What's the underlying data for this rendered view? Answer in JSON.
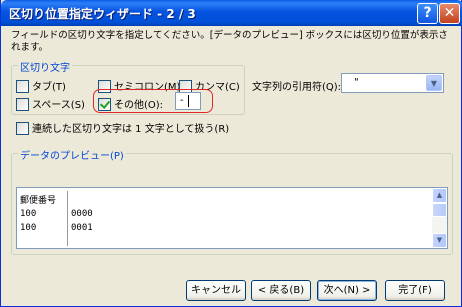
{
  "window": {
    "title": "区切り位置指定ウィザード - 2 / 3",
    "help_glyph": "?",
    "close_glyph": "✕"
  },
  "instruction": "フィールドの区切り文字を指定してください。[データのプレビュー] ボックスには区切り位置が表示されます。",
  "delimiters": {
    "group_label": "区切り文字",
    "tab": {
      "label": "タブ(T)",
      "checked": false
    },
    "semicolon": {
      "label": "セミコロン(M)",
      "checked": false
    },
    "comma": {
      "label": "カンマ(C)",
      "checked": false
    },
    "space": {
      "label": "スペース(S)",
      "checked": false
    },
    "other": {
      "label": "その他(O):",
      "checked": true,
      "value": "-"
    }
  },
  "text_qualifier": {
    "label": "文字列の引用符(Q):",
    "value": "\""
  },
  "consecutive": {
    "label": "連続した区切り文字は 1 文字として扱う(R)",
    "checked": false
  },
  "preview": {
    "group_label": "データのプレビュー(P)",
    "columns": [
      [
        "郵便番号",
        "100",
        "100"
      ],
      [
        "",
        "0000",
        "0001"
      ]
    ]
  },
  "buttons": {
    "cancel": "キャンセル",
    "back": "< 戻る(B)",
    "next": "次へ(N) >",
    "finish": "完了(F)"
  },
  "colors": {
    "titlebar": "#0553e0",
    "group_label": "#0046d5",
    "highlight": "#e0282b",
    "window_bg": "#ece9d8"
  }
}
